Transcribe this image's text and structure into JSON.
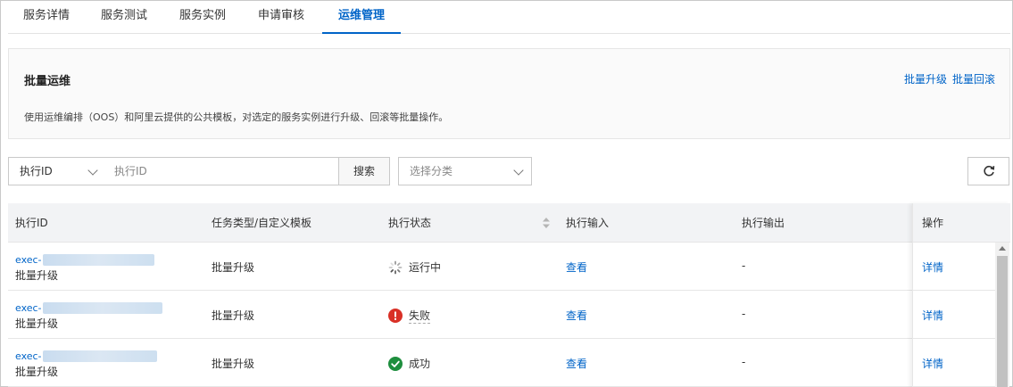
{
  "tabs": [
    {
      "label": "服务详情",
      "active": false
    },
    {
      "label": "服务测试",
      "active": false
    },
    {
      "label": "服务实例",
      "active": false
    },
    {
      "label": "申请审核",
      "active": false
    },
    {
      "label": "运维管理",
      "active": true
    }
  ],
  "batch_ops": {
    "title": "批量运维",
    "upgrade_link": "批量升级",
    "rollback_link": "批量回滚",
    "description": "使用运维编排（OOS）和阿里云提供的公共模板，对选定的服务实例进行升级、回滚等批量操作。"
  },
  "filter": {
    "field_select": "执行ID",
    "search_placeholder": "执行ID",
    "search_button": "搜索",
    "category_placeholder": "选择分类",
    "refresh_icon": "refresh-icon"
  },
  "table": {
    "headers": {
      "exec_id": "执行ID",
      "task_type": "任务类型/自定义模板",
      "status": "执行状态",
      "input": "执行输入",
      "output": "执行输出",
      "action": "操作"
    },
    "rows": [
      {
        "exec_prefix": "exec-",
        "exec_type": "批量升级",
        "task_type": "批量升级",
        "status": "运行中",
        "status_kind": "running",
        "input": "查看",
        "output": "-",
        "action": "详情"
      },
      {
        "exec_prefix": "exec-",
        "exec_type": "批量升级",
        "task_type": "批量升级",
        "status": "失败",
        "status_kind": "failed",
        "input": "查看",
        "output": "-",
        "action": "详情"
      },
      {
        "exec_prefix": "exec-",
        "exec_type": "批量升级",
        "task_type": "批量升级",
        "status": "成功",
        "status_kind": "success",
        "input": "查看",
        "output": "-",
        "action": "详情"
      }
    ]
  },
  "colors": {
    "accent": "#0064c8",
    "failed": "#d93026",
    "success": "#1e8e3e"
  }
}
